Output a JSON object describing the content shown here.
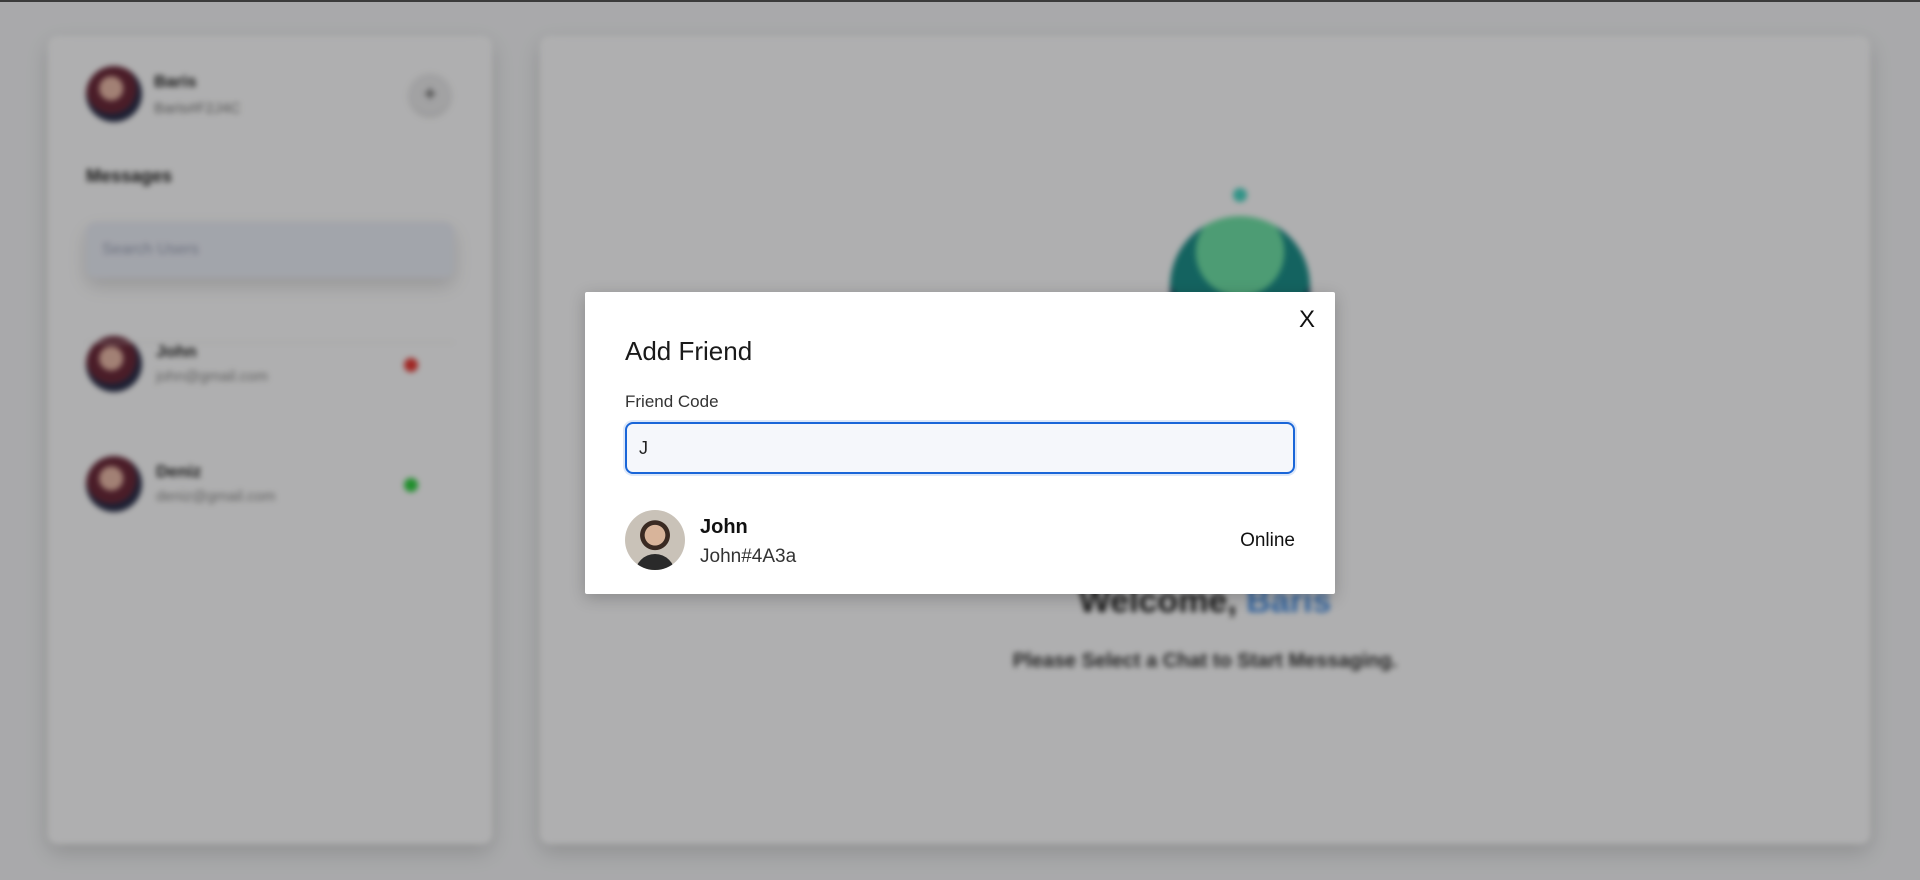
{
  "sidebar": {
    "profile": {
      "name": "Baris",
      "code": "Baris#F2J4C"
    },
    "add_button_icon": "plus-icon",
    "messages_title": "Messages",
    "search_placeholder": "Search Users",
    "contacts": [
      {
        "name": "John",
        "email": "john@gmail.com",
        "status_color": "#e53935"
      },
      {
        "name": "Deniz",
        "email": "deniz@gmail.com",
        "status_color": "#2ecc40"
      }
    ]
  },
  "main": {
    "welcome_prefix": "Welcome,",
    "welcome_name": "Baris",
    "subtitle": "Please Select a Chat to Start Messaging."
  },
  "modal": {
    "title": "Add Friend",
    "close_label": "X",
    "friend_code_label": "Friend Code",
    "friend_code_value": "J",
    "result": {
      "name": "John",
      "code": "John#4A3a",
      "status": "Online"
    }
  },
  "colors": {
    "accent": "#1a66d8",
    "welcome_accent": "#4a90e2"
  }
}
